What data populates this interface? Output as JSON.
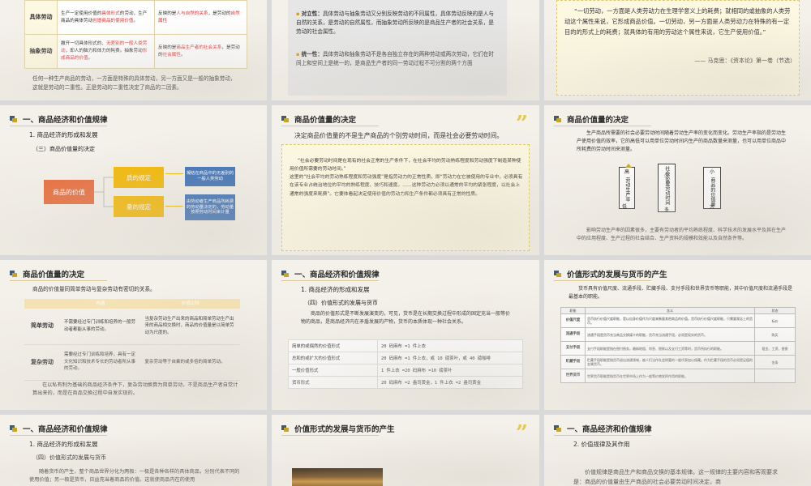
{
  "s1": {
    "row1_label": "具体劳动",
    "row1_left_a": "生产一定使用价值的",
    "row1_left_b": "具体形式",
    "row1_left_c": "的劳动，生产商品的具体劳动",
    "row1_left_d": "创造商品的使用价值",
    "row1_left_e": "。",
    "row1_right_a": "反映的是",
    "row1_right_b": "人与自然的关系",
    "row1_right_c": "，是劳动的",
    "row1_right_d": "自然属性",
    "row2_label": "抽象劳动",
    "row2_left_a": "撇开一切具体形式的、",
    "row2_left_b": "无差别的一般人类劳动",
    "row2_left_c": "，即人的脑力和体力的耗费。抽象劳动",
    "row2_left_d": "形成商品的价值",
    "row2_left_e": "。",
    "row2_right_a": "反映的是",
    "row2_right_b": "商品生产者的社会关系",
    "row2_right_c": "，是劳动的",
    "row2_right_d": "社会属性",
    "row2_right_e": "。",
    "footer": "任何一种生产商品的劳动，一方面是特殊的具体劳动，另一方面又是一般的抽象劳动，这就是劳动的二重性。正是劳动的二重性决定了商品的二因素。"
  },
  "s2": {
    "p1_label": "对立性：",
    "p1": "具体劳动与抽象劳动又分别反映劳动的不同属性，具体劳动反映的是人与自然的关系，是劳动的自然属性，而抽象劳动所反映的是商品生产者的社会关系，是劳动的社会属性。",
    "p2_label": "统一性：",
    "p2": "具体劳动和抽象劳动不是各自独立存在的两种劳动或两次劳动，它们在时间上和空间上是统一的，是商品生产者的同一劳动过程不可分割的两个方面"
  },
  "s3": {
    "quote": "“一切劳动，一方面是人类劳动力在生理学意义上的耗费；就相同的或抽象的人类劳动这个属性来说，它形成商品价值。一切劳动，另一方面是人类劳动力在特殊的有一定目的的形式上的耗费；就具体的有用的劳动这个属性来说，它生产使用价值。”",
    "source": "—— 马克思：《资本论》第一卷（节选）"
  },
  "s4": {
    "title": "一、商品经济和价值规律",
    "sub1": "1. 商品经济的形成和发展",
    "sub2": "（三）商品价值量的决定",
    "center": "商品的价值",
    "q_label": "质的规定",
    "n_label": "量的规定",
    "q_desc": "凝结在商品中的无差别的一般人类劳动",
    "n_desc": "由劳动者生产商品所耗费的劳动量决定的，劳动量按照劳动时间来计量"
  },
  "s5": {
    "title": "商品价值量的决定",
    "lead": "决定商品价值量的不是生产商品的个别劳动时间，而是社会必要劳动时间。",
    "box": "“社会必要劳动时间是在现有的社会正常的生产条件下，在社会平均的劳动熟练程度和劳动强度下制造某种使用价值所需要的劳动时间。”\n这里的“社会平均的劳动熟练程度和劳动强度”是指劳动力的正常性质，即“劳动力在它被使用的专业中，必须具有在该专业占统治地位的平均的熟练程度、技巧和速度。……这种劳动力必须以通常的平均的紧张程度，以社会上通常的强度来耗费”。它要体看起决定使用价值的劳动力和生产条件都必须具有正常的性质。"
  },
  "s6": {
    "title": "商品价值量的决定",
    "p1": "生产商品所需要的社会必要劳动时间随着劳动生产率的变化而变化。劳动生产率指的是劳动生产使用价值的效率，它的高低可以用单位劳动时间内生产的商品数量来测量，也可以用单位商品中所耗费的劳动时间来测量。",
    "b1": "劳动生产率",
    "b1_hi": "高",
    "b1_lo": "低",
    "b2": "社会必要劳动时间",
    "b2_hi": "少",
    "b2_lo": "多",
    "b3": "商品的价值量",
    "b3_hi": "小",
    "b3_lo": "大",
    "p2": "影响劳动生产率的因素很多，主要有劳动者的平均熟练程度、科学技术的发展水平及其在生产中的应用程度、生产过程的社会结合、生产资料的规模和效能以及自然条件等。"
  },
  "s7": {
    "title": "商品价值量的决定",
    "lead": "商品的价值量同简单劳动与复杂劳动有密切的关系。",
    "col1": "内涵",
    "col2": "价值比较",
    "r1_label": "简单劳动",
    "r1_a": "不需要经过专门训练和培养的一般劳动者都能从事的劳动。",
    "r1_b": "当复杂劳动生产出来的商品和简单劳动生产出来的商品相交换时，商品的价值量是以简单劳动为尺度的。",
    "r2_label": "复杂劳动",
    "r2_a": "需要经过专门训练和培养，具有一定文化知识和技术专长的劳动者所从事的劳动。",
    "r2_b": "复杂劳动等于自乘的或多倍的简单劳动。",
    "footer": "在以私有制为基础的商品经济条件下，复杂劳动换算为简单劳动，不是商品生产者自觉计算出来的，而是在商品交换过程中自发实现的。"
  },
  "s8": {
    "title": "一、商品经济和价值规律",
    "sub1": "1. 商品经济的形成和发展",
    "sub2": "（四）价值形式的发展与货币",
    "p1": "商品的价值形式是不断发展演变的，可见，货币是在长期交换过程中形成的固定充当一般等价物的商品，是商品经济内在矛盾发展的产物，货币的本质体现一种社会关系。",
    "rows": [
      [
        "简单的或偶然的价值形式",
        "20 码麻布 =1 件上衣"
      ],
      [
        "总和的或扩大的价值形式",
        "20 码麻布 =1 件上衣，或 10 磅茶叶，或 40 磅咖啡"
      ],
      [
        "一般价值形式",
        "1 件上衣 =20 码麻布 =10 磅茶叶"
      ],
      [
        "货币形式",
        "20 码麻布 =2 盎司黄金，1 件上衣 =2 盎司黄金"
      ]
    ]
  },
  "s9": {
    "title": "价值形式的发展与货币的产生",
    "lead": "货币具有价值尺度、流通手段、贮藏手段、支付手段和世界货币等职能，其中价值尺度和流通手段是最基本的职能。",
    "head": [
      "职能",
      "含义",
      "状态"
    ],
    "rows": [
      [
        "价值尺度",
        "货币执行价值尺度职能，是以自身价值作为尺度来衡量其他商品的价值。货币执行价值尺度职能，只需要观念上的货币。",
        "标价"
      ],
      [
        "流通手段",
        "流通手段是货币充当商品交换媒介的职能，货币充当流通手段，必须是现实的货币。",
        "购买"
      ],
      [
        "支付手段",
        "支付手段职能是指在偿付债务，缴纳地租、利息、税款以及支付工资等时，货币所执行的职能。",
        "租金、工资、偿债"
      ],
      [
        "贮藏手段",
        "贮藏手段职能是指货币退出流通领域，被人们当作社会财富的一般代表加以保藏。作为贮藏手段的货币必须是足值的金属货币。",
        "金条"
      ],
      [
        "世界货币",
        "世界货币职能是指货币在世界市场上作为一般等价物发挥作用的职能。",
        ""
      ]
    ]
  },
  "s10": {
    "title": "一、商品经济和价值规律",
    "sub1": "1. 商品经济的形成和发展",
    "sub2": "（四）价值形式的发展与货币",
    "p1": "随着货币的产生，整个商品世界分化为两极：一极是各种各样的具体商品，分别代表不同的使用价值；另一极是货币，日益充当着商品的价值。这就使商品内在的使用"
  },
  "s11": {
    "title": "价值形式的发展与货币的产生"
  },
  "s12": {
    "title": "一、商品经济和价值规律",
    "sub1": "2. 价值规律及其作用",
    "p1": "价值规律是商品生产和商品交换的基本规律。这一规律的主要内容和客观要求是：商品的价值量由生产商品的社会必要劳动时间决定，商"
  }
}
